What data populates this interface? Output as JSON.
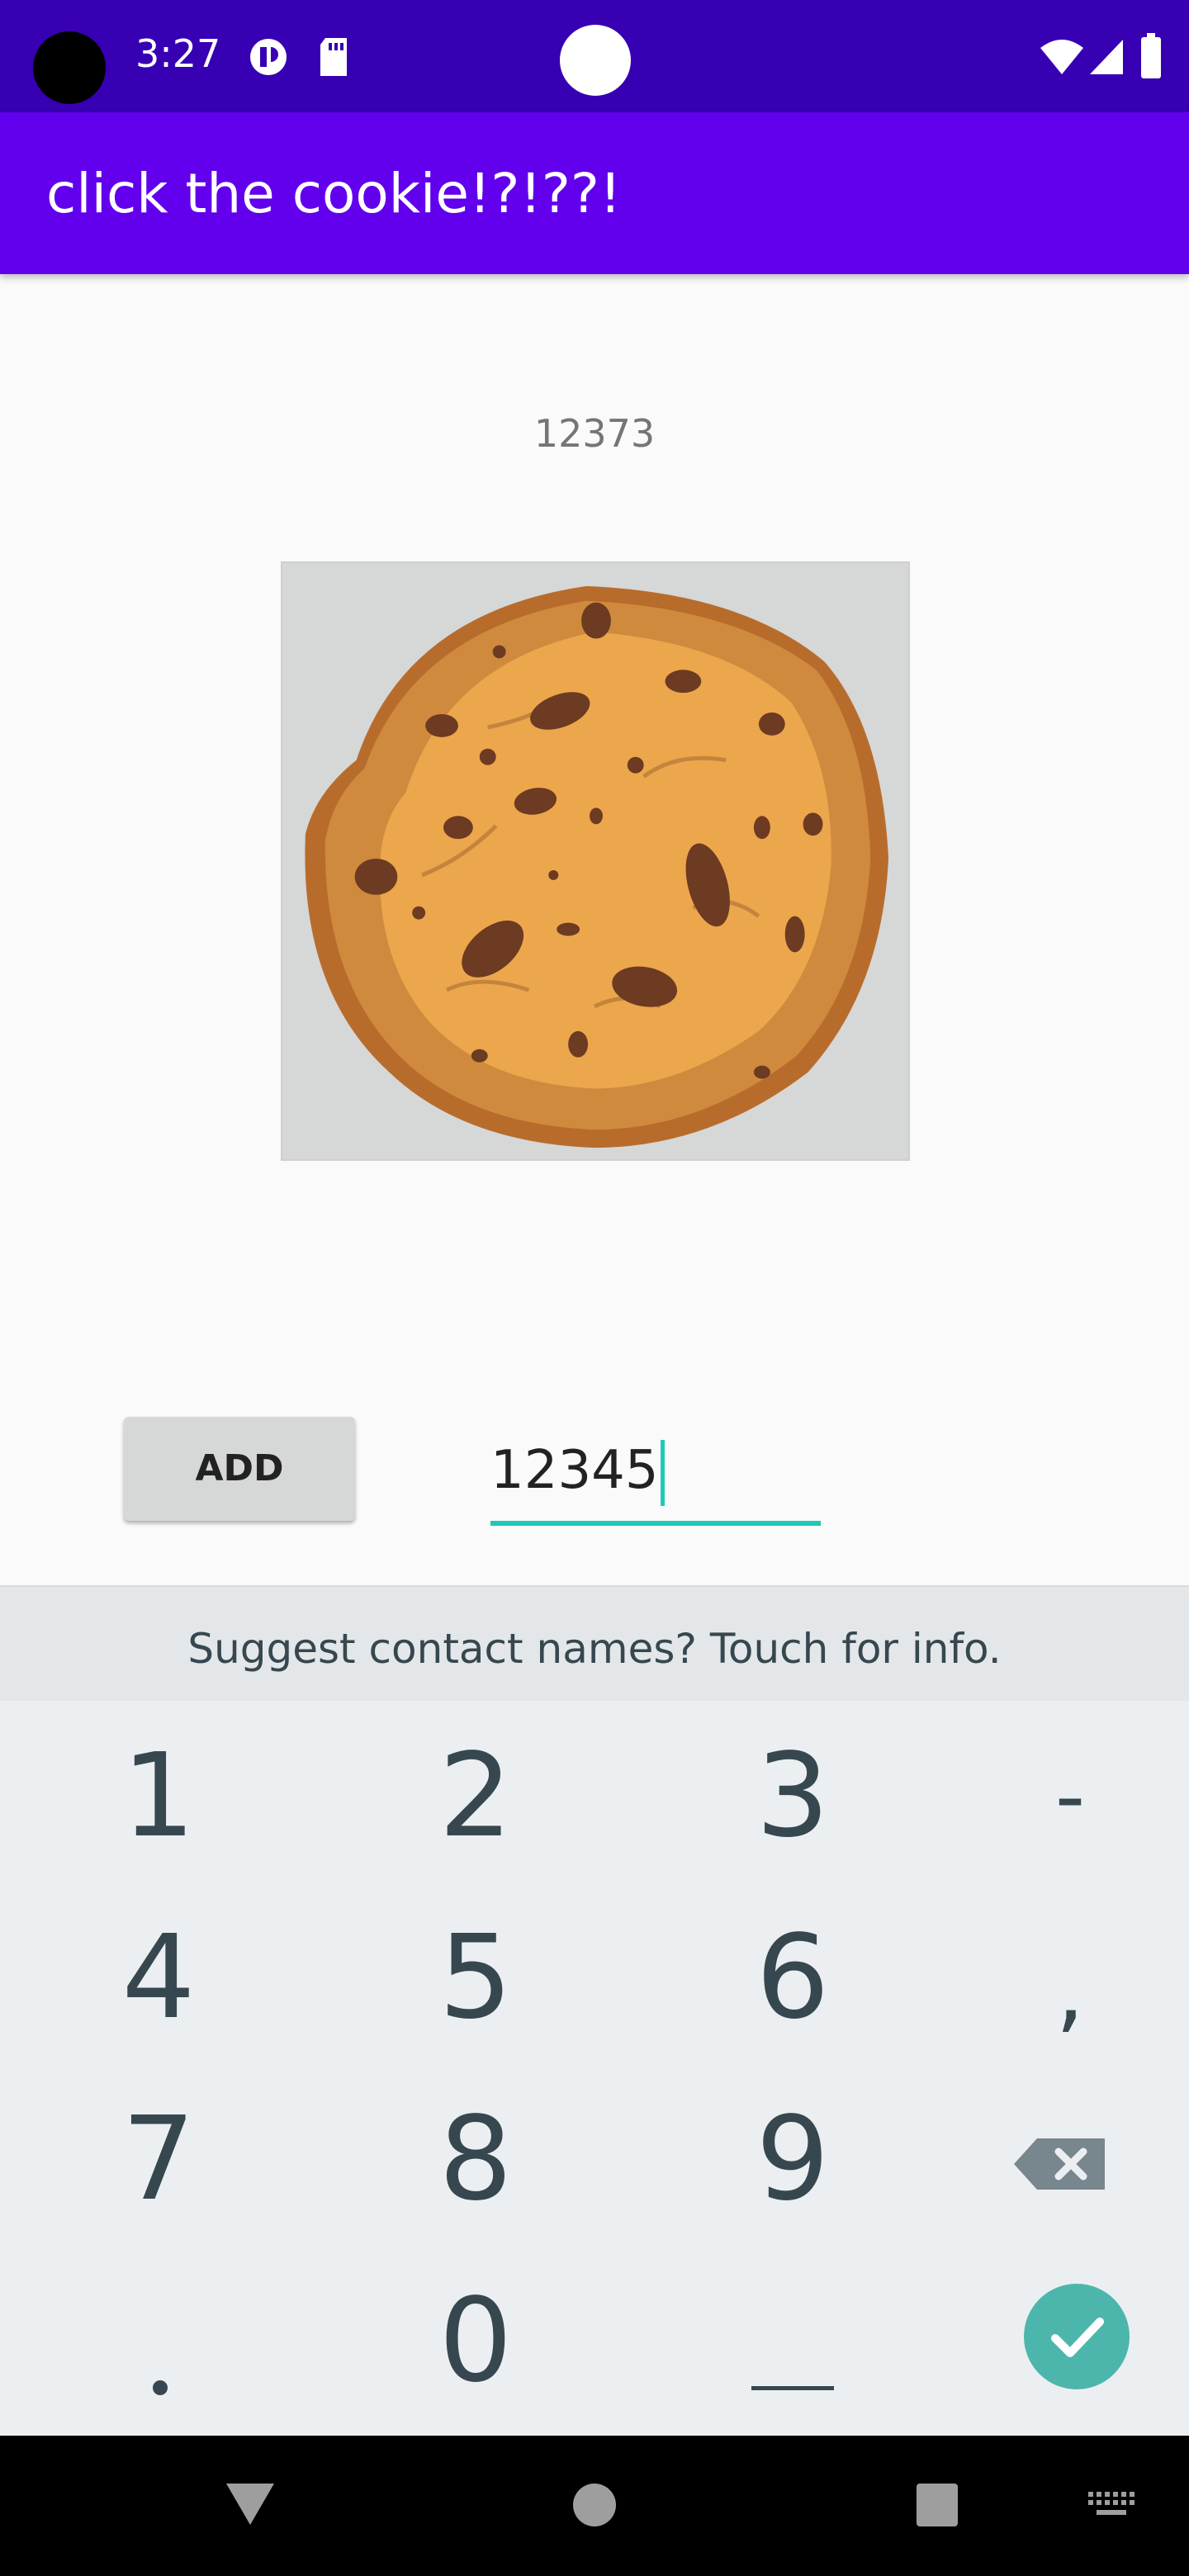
{
  "status_bar": {
    "time": "3:27",
    "icons": [
      "camera-hole",
      "notification-circle-icon",
      "sd-card-icon",
      "wifi-icon",
      "cell-signal-icon",
      "battery-icon"
    ]
  },
  "app_bar": {
    "title": "click the cookie!?!??!"
  },
  "main": {
    "counter": "12373",
    "cookie_image": "cookie-image",
    "add_button_label": "ADD",
    "input_value": "12345"
  },
  "keyboard": {
    "suggestion": "Suggest contact names? Touch for info.",
    "rows": [
      [
        "1",
        "2",
        "3",
        "-"
      ],
      [
        "4",
        "5",
        "6",
        ","
      ],
      [
        "7",
        "8",
        "9",
        "backspace"
      ],
      [
        ".",
        "0",
        "space",
        "done"
      ]
    ]
  },
  "navigation": {
    "buttons": [
      "back-icon",
      "home-icon",
      "recents-icon",
      "keyboard-switch-icon"
    ]
  },
  "colors": {
    "status_bar": "#3700b3",
    "app_bar": "#6200ee",
    "accent": "#1ec9b8",
    "done_key": "#4db6ac"
  }
}
